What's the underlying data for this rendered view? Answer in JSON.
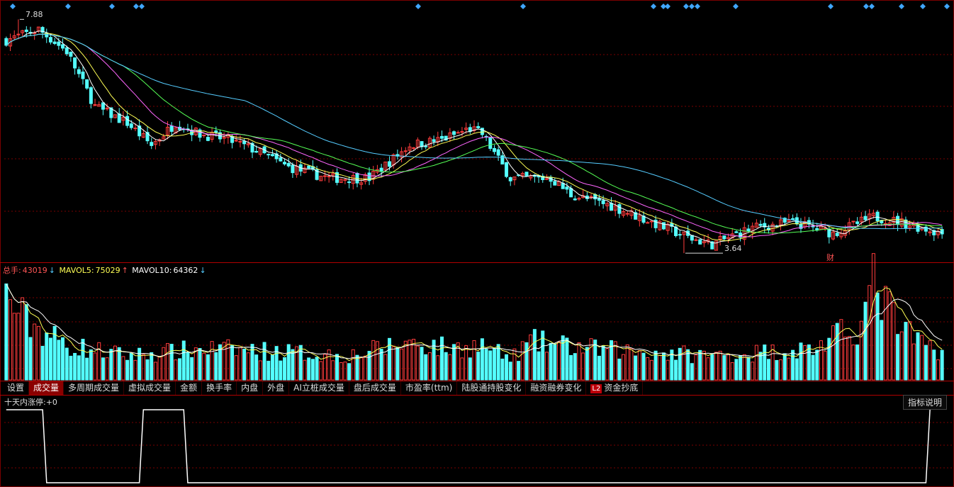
{
  "colors": {
    "up": "#ff3c3c",
    "down": "#54ffff",
    "ma5": "#ffffff",
    "ma10": "#ffff55",
    "ma20": "#ff66ff",
    "ma30": "#55ff55",
    "ma60": "#55ccff",
    "grid": "#7a0000",
    "diamond": "#3fa6ff"
  },
  "price": {
    "high_label": "7.88",
    "low_label": "3.64",
    "finance_marker": "财"
  },
  "volume_legend": {
    "total": {
      "label": "总手:",
      "value": "43019",
      "arrow": "↓"
    },
    "ma5": {
      "label": "MAVOL5:",
      "value": "75029",
      "arrow": "↑"
    },
    "ma10": {
      "label": "MAVOL10:",
      "value": "64362",
      "arrow": "↓"
    }
  },
  "tabs": [
    {
      "label": "设置",
      "active": false
    },
    {
      "label": "成交量",
      "active": true
    },
    {
      "label": "多周期成交量",
      "active": false
    },
    {
      "label": "虚拟成交量",
      "active": false
    },
    {
      "label": "金额",
      "active": false
    },
    {
      "label": "换手率",
      "active": false
    },
    {
      "label": "内盘",
      "active": false
    },
    {
      "label": "外盘",
      "active": false
    },
    {
      "label": "AI立桩成交量",
      "active": false
    },
    {
      "label": "盘后成交量",
      "active": false
    },
    {
      "label": "市盈率(ttm)",
      "active": false
    },
    {
      "label": "陆股通持股变化",
      "active": false
    },
    {
      "label": "融资融券变化",
      "active": false
    },
    {
      "label": "资金抄底",
      "active": false,
      "badge": "L2"
    }
  ],
  "indicator": {
    "label": "十天内涨停:",
    "value": "+0",
    "help_button": "指标说明"
  },
  "chart_data": {
    "type": "candlestick",
    "price_range": [
      3.5,
      8.0
    ],
    "high": 7.88,
    "low": 3.64,
    "close_trend": [
      [
        0,
        7.5
      ],
      [
        8,
        7.7
      ],
      [
        15,
        7.3
      ],
      [
        22,
        6.3
      ],
      [
        30,
        6.0
      ],
      [
        36,
        5.6
      ],
      [
        42,
        6.0
      ],
      [
        48,
        5.8
      ],
      [
        55,
        5.7
      ],
      [
        62,
        5.5
      ],
      [
        70,
        5.2
      ],
      [
        80,
        5.0
      ],
      [
        90,
        5.0
      ],
      [
        100,
        5.6
      ],
      [
        108,
        5.7
      ],
      [
        115,
        5.9
      ],
      [
        118,
        5.8
      ],
      [
        125,
        5.0
      ],
      [
        135,
        5.0
      ],
      [
        140,
        4.7
      ],
      [
        150,
        4.5
      ],
      [
        160,
        4.2
      ],
      [
        170,
        3.9
      ],
      [
        175,
        3.8
      ],
      [
        185,
        4.1
      ],
      [
        195,
        4.2
      ],
      [
        205,
        4.0
      ],
      [
        215,
        4.3
      ],
      [
        222,
        4.2
      ],
      [
        232,
        4.0
      ]
    ],
    "volume_range": [
      0,
      150000
    ],
    "volume_trend": [
      [
        0,
        120000
      ],
      [
        5,
        85000
      ],
      [
        15,
        50000
      ],
      [
        30,
        35000
      ],
      [
        50,
        45000
      ],
      [
        70,
        40000
      ],
      [
        85,
        35000
      ],
      [
        100,
        55000
      ],
      [
        110,
        45000
      ],
      [
        118,
        50000
      ],
      [
        125,
        30000
      ],
      [
        130,
        55000
      ],
      [
        145,
        45000
      ],
      [
        160,
        40000
      ],
      [
        175,
        35000
      ],
      [
        200,
        45000
      ],
      [
        212,
        80000
      ],
      [
        215,
        140000
      ],
      [
        222,
        70000
      ],
      [
        228,
        50000
      ],
      [
        232,
        43019
      ]
    ],
    "indicator_signal": [
      [
        0,
        1
      ],
      [
        9,
        1
      ],
      [
        10,
        0
      ],
      [
        33,
        0
      ],
      [
        34,
        1
      ],
      [
        44,
        1
      ],
      [
        45,
        0
      ],
      [
        228,
        0
      ],
      [
        229,
        1
      ]
    ]
  }
}
